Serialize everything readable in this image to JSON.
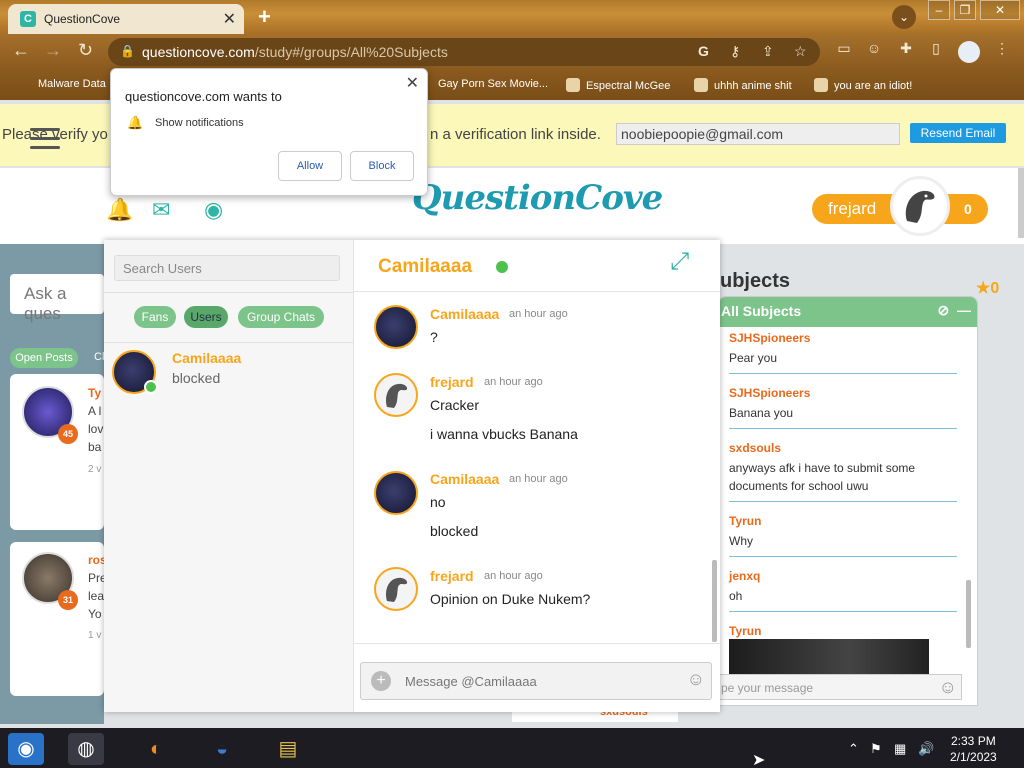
{
  "browser": {
    "tab_title": "QuestionCove",
    "tab_favicon": "C",
    "url_host": "questioncove.com",
    "url_path": "/study#/groups/All%20Subjects",
    "bookmarks": [
      "Malware Data",
      "Gay Porn Sex Movie...",
      "Espectral McGee",
      "uhhh anime shit",
      "you are an idiot!"
    ]
  },
  "notification": {
    "title": "questioncove.com wants to",
    "body": "Show notifications",
    "allow": "Allow",
    "block": "Block",
    "close": "✕"
  },
  "verify": {
    "text_left": "Please verify yo",
    "text_right": "n a verification link inside.",
    "email": "noobiepoopie@gmail.com",
    "resend": "Resend Email"
  },
  "header": {
    "logo": "QuestionCove",
    "username": "frejard",
    "points": "0"
  },
  "left_page": {
    "ask_placeholder": "Ask a ques",
    "open_posts": "Open Posts",
    "closed": "Cl",
    "posts": [
      {
        "name": "Ty",
        "line1": "A l",
        "line2": "lov",
        "line3": "ba",
        "meta": "2 v",
        "badge": "45"
      },
      {
        "name": "ros",
        "line1": "Pre",
        "line2": "lea",
        "line3": "Yo",
        "meta": "1 v",
        "badge": "31"
      }
    ]
  },
  "chat": {
    "search_placeholder": "Search Users",
    "filters": [
      "Fans",
      "Users",
      "Group Chats"
    ],
    "active_filter": "Users",
    "contact": {
      "name": "Camilaaaa",
      "status": "blocked"
    },
    "title": "Camilaaaa",
    "messages": [
      {
        "name": "Camilaaaa",
        "time": "an hour ago",
        "lines": [
          "?"
        ]
      },
      {
        "name": "frejard",
        "time": "an hour ago",
        "lines": [
          "Cracker",
          "i wanna vbucks Banana"
        ]
      },
      {
        "name": "Camilaaaa",
        "time": "an hour ago",
        "lines": [
          "no",
          "blocked"
        ]
      },
      {
        "name": "frejard",
        "time": "an hour ago",
        "lines": [
          "Opinion on Duke Nukem?"
        ]
      }
    ],
    "input_placeholder": "Message @Camilaaaa"
  },
  "all_subjects": {
    "page_title": "ubjects",
    "star_count": "0",
    "panel_title": "All Subjects",
    "messages": [
      {
        "name": "SJHSpioneers",
        "text": "Pear you"
      },
      {
        "name": "SJHSpioneers",
        "text": "Banana you"
      },
      {
        "name": "sxdsouls",
        "text": "anyways afk i have to submit some documents for school uwu"
      },
      {
        "name": "Tyrun",
        "text": "Why"
      },
      {
        "name": "jenxq",
        "text": "oh"
      },
      {
        "name": "Tyrun",
        "text": ""
      }
    ],
    "input_placeholder": "pe your message",
    "bottom_name": "sxdsouls"
  },
  "taskbar": {
    "time": "2:33 PM",
    "date": "2/1/2023"
  },
  "colors": {
    "brand_orange": "#f7a51b",
    "brand_teal": "#2fb5a5",
    "brand_green": "#7dc48b"
  }
}
